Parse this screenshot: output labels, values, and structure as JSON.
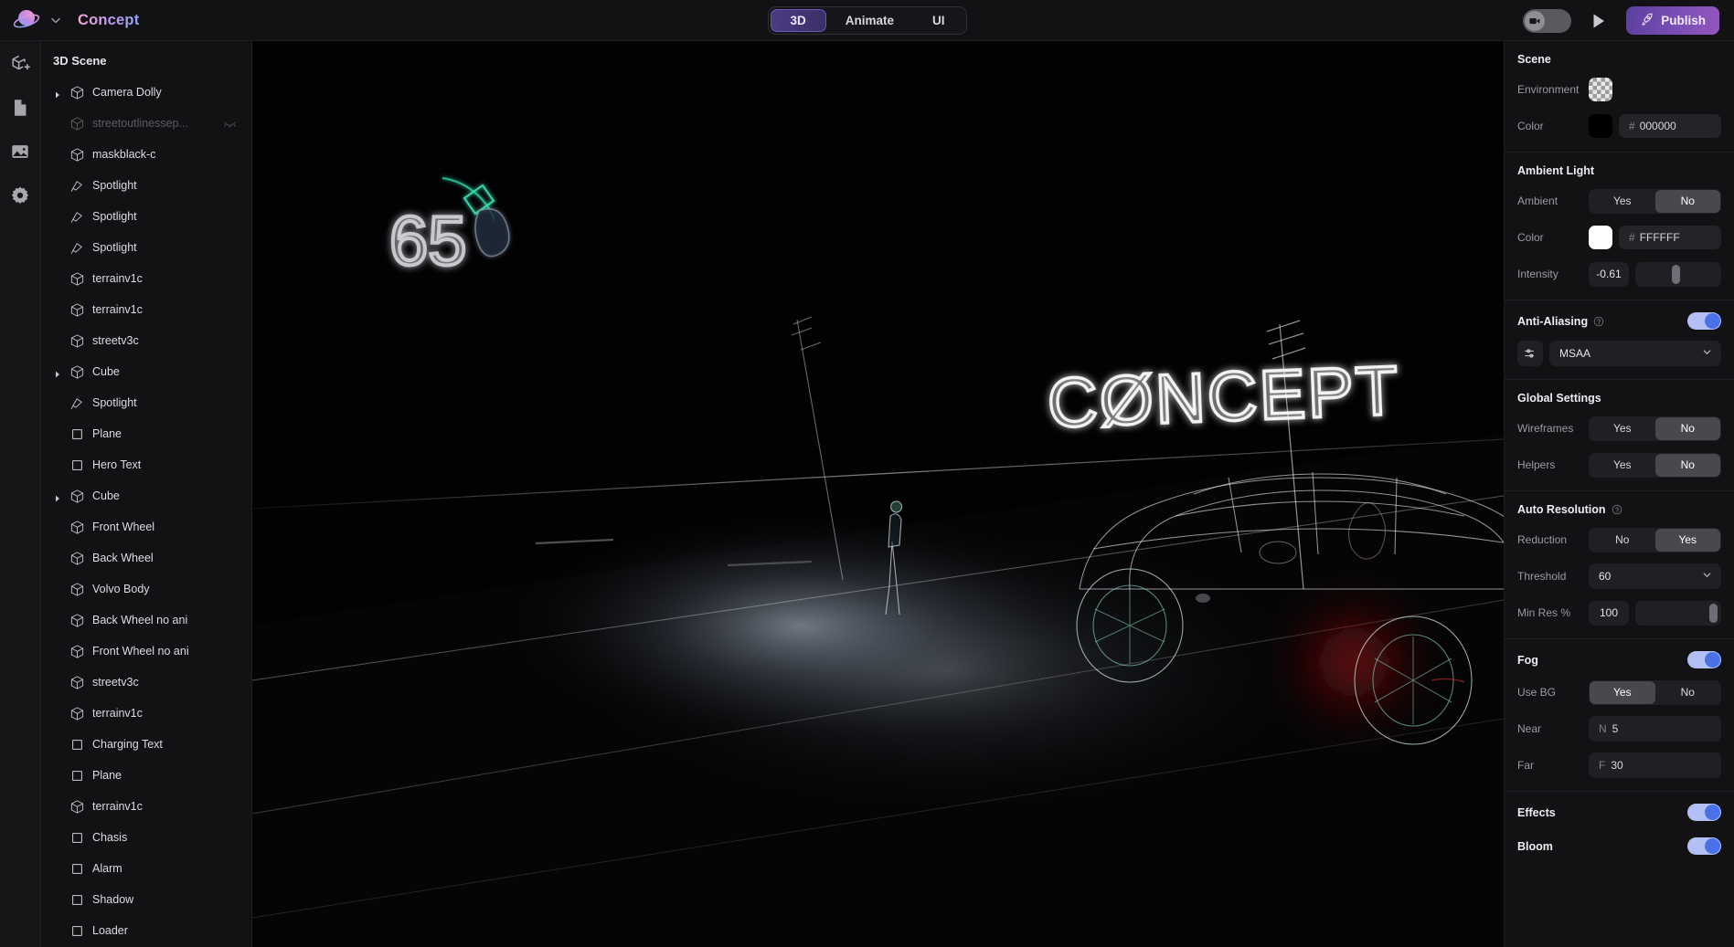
{
  "app": {
    "project_title": "Concept",
    "logo_icon": "planet-logo",
    "project_chevron_icon": "chevron-down-icon"
  },
  "tabs": [
    {
      "label": "3D",
      "active": true
    },
    {
      "label": "Animate",
      "active": false
    },
    {
      "label": "UI",
      "active": false
    }
  ],
  "topright": {
    "camera_toggle_icon": "video-camera-icon",
    "play_icon": "play-icon",
    "publish_label": "Publish",
    "publish_icon": "rocket-icon"
  },
  "rail": [
    {
      "name": "add-object-icon"
    },
    {
      "name": "page-icon"
    },
    {
      "name": "image-icon"
    },
    {
      "name": "gear-icon"
    }
  ],
  "layers": {
    "title": "3D Scene",
    "items": [
      {
        "label": "Camera Dolly",
        "icon": "cube-icon",
        "twisty": true,
        "hidden": false
      },
      {
        "label": "streetoutlinessep...",
        "icon": "cube-icon",
        "twisty": false,
        "hidden": true
      },
      {
        "label": "maskblack-c",
        "icon": "cube-icon",
        "twisty": false,
        "hidden": false
      },
      {
        "label": "Spotlight",
        "icon": "spotlight-icon",
        "twisty": false,
        "hidden": false
      },
      {
        "label": "Spotlight",
        "icon": "spotlight-icon",
        "twisty": false,
        "hidden": false
      },
      {
        "label": "Spotlight",
        "icon": "spotlight-icon",
        "twisty": false,
        "hidden": false
      },
      {
        "label": "terrainv1c",
        "icon": "cube-icon",
        "twisty": false,
        "hidden": false
      },
      {
        "label": "terrainv1c",
        "icon": "cube-icon",
        "twisty": false,
        "hidden": false
      },
      {
        "label": "streetv3c",
        "icon": "cube-icon",
        "twisty": false,
        "hidden": false
      },
      {
        "label": "Cube",
        "icon": "cube-icon",
        "twisty": true,
        "hidden": false
      },
      {
        "label": "Spotlight",
        "icon": "spotlight-icon",
        "twisty": false,
        "hidden": false
      },
      {
        "label": "Plane",
        "icon": "plane-icon",
        "twisty": false,
        "hidden": false
      },
      {
        "label": "Hero Text",
        "icon": "plane-icon",
        "twisty": false,
        "hidden": false
      },
      {
        "label": "Cube",
        "icon": "cube-icon",
        "twisty": true,
        "hidden": false
      },
      {
        "label": "Front Wheel",
        "icon": "cube-icon",
        "twisty": false,
        "hidden": false
      },
      {
        "label": "Back Wheel",
        "icon": "cube-icon",
        "twisty": false,
        "hidden": false
      },
      {
        "label": "Volvo Body",
        "icon": "cube-icon",
        "twisty": false,
        "hidden": false
      },
      {
        "label": "Back Wheel no ani",
        "icon": "cube-icon",
        "twisty": false,
        "hidden": false
      },
      {
        "label": "Front Wheel no ani",
        "icon": "cube-icon",
        "twisty": false,
        "hidden": false
      },
      {
        "label": "streetv3c",
        "icon": "cube-icon",
        "twisty": false,
        "hidden": false
      },
      {
        "label": "terrainv1c",
        "icon": "cube-icon",
        "twisty": false,
        "hidden": false
      },
      {
        "label": "Charging Text",
        "icon": "plane-icon",
        "twisty": false,
        "hidden": false
      },
      {
        "label": "Plane",
        "icon": "plane-icon",
        "twisty": false,
        "hidden": false
      },
      {
        "label": "terrainv1c",
        "icon": "cube-icon",
        "twisty": false,
        "hidden": false
      },
      {
        "label": "Chasis",
        "icon": "plane-icon",
        "twisty": false,
        "hidden": false
      },
      {
        "label": "Alarm",
        "icon": "plane-icon",
        "twisty": false,
        "hidden": false
      },
      {
        "label": "Shadow",
        "icon": "plane-icon",
        "twisty": false,
        "hidden": false
      },
      {
        "label": "Loader",
        "icon": "plane-icon",
        "twisty": false,
        "hidden": false
      }
    ]
  },
  "viewport": {
    "hero_text": "CØNCEPT",
    "charging_value": "65",
    "charging_icon": "charging-plug-icon"
  },
  "props": {
    "scene": {
      "title": "Scene",
      "environment_label": "Environment",
      "environment_swatch": "checker",
      "color_label": "Color",
      "color_swatch": "#000000",
      "color_hash": "#",
      "color_hex": "000000"
    },
    "ambient": {
      "title": "Ambient Light",
      "ambient_label": "Ambient",
      "ambient_options": [
        "Yes",
        "No"
      ],
      "ambient_selected": "No",
      "color_label": "Color",
      "color_swatch": "#FFFFFF",
      "color_hash": "#",
      "color_hex": "FFFFFF",
      "intensity_label": "Intensity",
      "intensity_value": "-0.61",
      "intensity_pct": 48
    },
    "antialiasing": {
      "title": "Anti-Aliasing",
      "help_icon": "help-circle-icon",
      "enabled": true,
      "settings_icon": "sliders-icon",
      "mode_value": "MSAA",
      "chevron_icon": "chevron-down-icon"
    },
    "global": {
      "title": "Global Settings",
      "wireframes_label": "Wireframes",
      "wireframes_options": [
        "Yes",
        "No"
      ],
      "wireframes_selected": "No",
      "helpers_label": "Helpers",
      "helpers_options": [
        "Yes",
        "No"
      ],
      "helpers_selected": "No"
    },
    "autores": {
      "title": "Auto Resolution",
      "help_icon": "help-circle-icon",
      "reduction_label": "Reduction",
      "reduction_options": [
        "No",
        "Yes"
      ],
      "reduction_selected": "Yes",
      "threshold_label": "Threshold",
      "threshold_value": "60",
      "minres_label": "Min Res %",
      "minres_value": "100",
      "minres_pct": 97
    },
    "fog": {
      "title": "Fog",
      "enabled": true,
      "usebg_label": "Use BG",
      "usebg_options": [
        "Yes",
        "No"
      ],
      "usebg_selected": "Yes",
      "near_label": "Near",
      "near_prefix": "N",
      "near_value": "5",
      "far_label": "Far",
      "far_prefix": "F",
      "far_value": "30"
    },
    "effects": {
      "title": "Effects",
      "enabled": true,
      "bloom_label": "Bloom",
      "bloom_enabled": true
    }
  }
}
